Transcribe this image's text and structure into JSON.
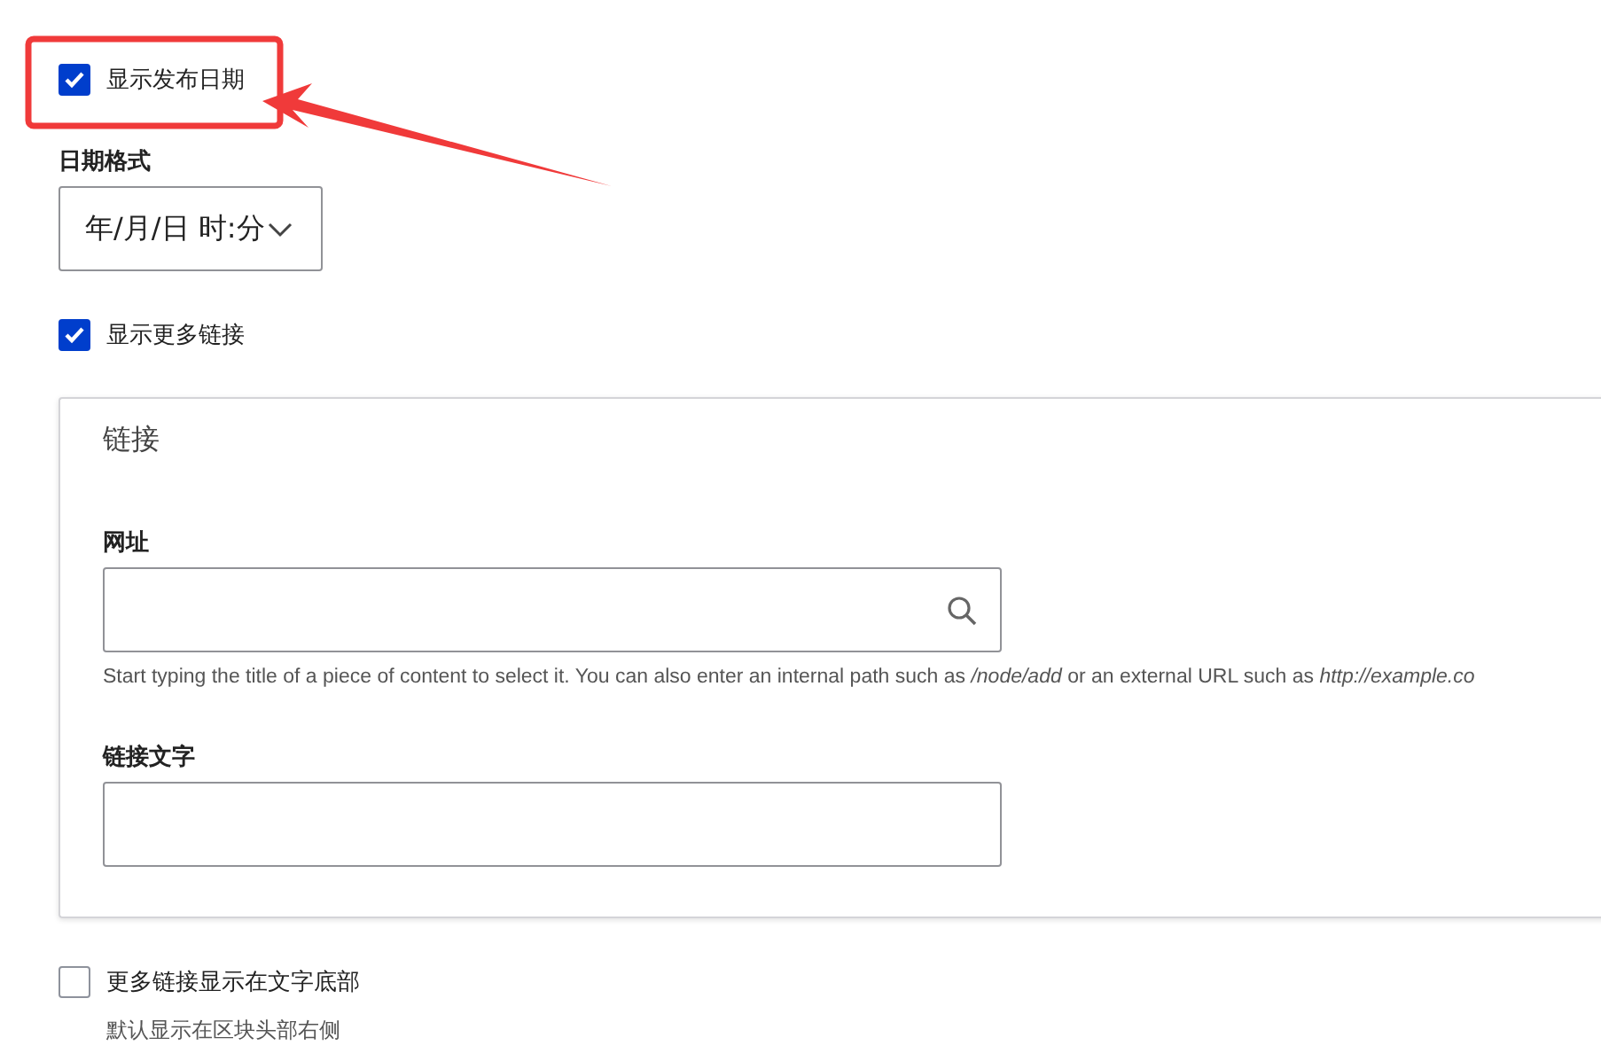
{
  "show_date": {
    "label": "显示发布日期",
    "checked": true
  },
  "date_format": {
    "label": "日期格式",
    "value": "年/月/日 时:分"
  },
  "show_more_links": {
    "label": "显示更多链接",
    "checked": true
  },
  "links_fieldset": {
    "legend": "链接",
    "url": {
      "label": "网址",
      "description": "Start typing the title of a piece of content to select it. You can also enter an internal path such as */node/add* or an external URL such as *http://example.co*"
    },
    "link_text": {
      "label": "链接文字"
    }
  },
  "links_at_bottom": {
    "label": "更多链接显示在文字底部",
    "checked": false,
    "description": "默认显示在区块头部右侧"
  }
}
